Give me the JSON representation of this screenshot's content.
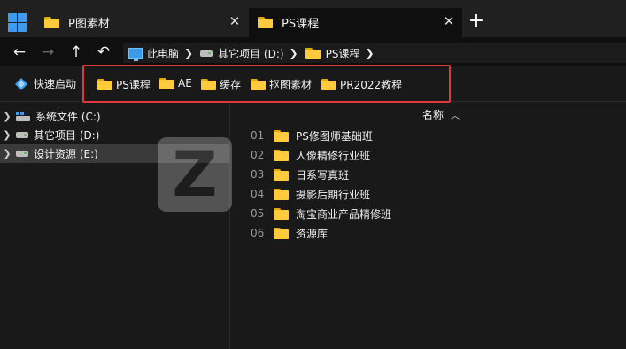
{
  "tabs": [
    {
      "label": "P图素材",
      "active": false
    },
    {
      "label": "PS课程",
      "active": true
    }
  ],
  "new_tab_symbol": "+",
  "nav": {
    "back": "←",
    "forward": "→",
    "up": "↑",
    "refresh": "↶"
  },
  "breadcrumb": [
    "此电脑",
    "其它项目 (D:)",
    "PS课程"
  ],
  "quickbar": {
    "launch_label": "快速启动",
    "items": [
      "PS课程",
      "AE",
      "缓存",
      "抠图素材",
      "PR2022教程"
    ]
  },
  "tree": [
    {
      "label": "系统文件 (C:)",
      "selected": false
    },
    {
      "label": "其它项目 (D:)",
      "selected": false
    },
    {
      "label": "设计资源 (E:)",
      "selected": true
    }
  ],
  "column_header": "名称",
  "files": [
    {
      "num": "01",
      "name": "PS修图师基础班"
    },
    {
      "num": "02",
      "name": "人像精修行业班"
    },
    {
      "num": "03",
      "name": "日系写真班"
    },
    {
      "num": "04",
      "name": "摄影后期行业班"
    },
    {
      "num": "05",
      "name": "淘宝商业产品精修班"
    },
    {
      "num": "06",
      "name": "资源库"
    }
  ],
  "colors": {
    "accent": "#3f9bf0",
    "folder": "#ffcb3d",
    "highlight": "#e0393b",
    "background": "#191919"
  }
}
